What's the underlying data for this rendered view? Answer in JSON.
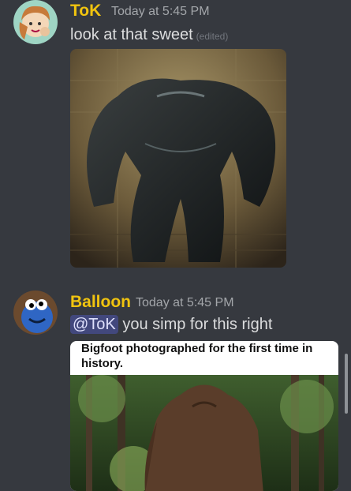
{
  "messages": [
    {
      "author": "ToK",
      "timestamp": "Today at 5:45 PM",
      "text": "look at that sweet",
      "edited_label": "(edited)",
      "author_color": "#f1c40f",
      "attachment": "image"
    },
    {
      "author": "Balloon",
      "timestamp": "Today at 5:45 PM",
      "mention": "@ToK",
      "text": "you simp for this right",
      "author_color": "#f1c40f",
      "embed": {
        "caption": "Bigfoot photographed for the first time in history."
      }
    }
  ],
  "colors": {
    "background": "#36393f",
    "mention_bg": "#4a4f8c",
    "timestamp": "#a3a6aa",
    "text": "#dcddde"
  }
}
